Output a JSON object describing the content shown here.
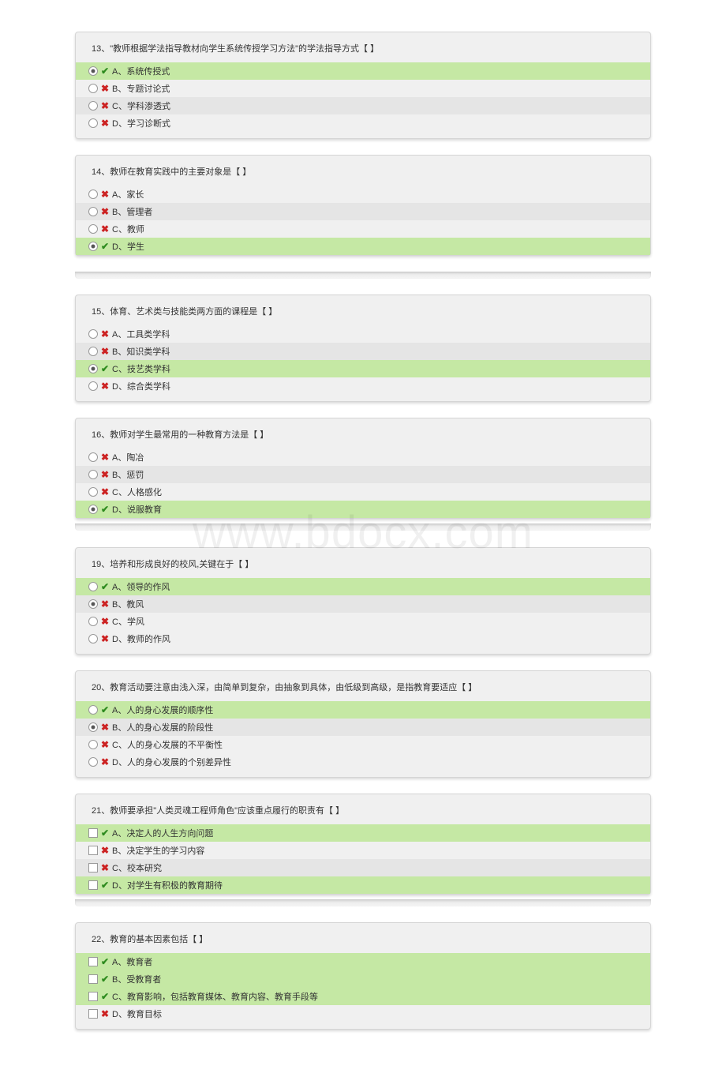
{
  "watermark": "www.bdocx.com",
  "questions": [
    {
      "num": "13",
      "title": "13、\"教师根据学法指导教材向学生系统传授学习方法\"的学法指导方式【  】",
      "options": [
        {
          "mark": "check",
          "text": "A、系统传授式",
          "correct": true,
          "selected": true
        },
        {
          "mark": "cross",
          "text": "B、专题讨论式",
          "alt": false
        },
        {
          "mark": "cross",
          "text": "C、学科渗透式",
          "alt": true
        },
        {
          "mark": "cross",
          "text": "D、学习诊断式",
          "alt": false
        }
      ]
    },
    {
      "num": "14",
      "title": "14、教师在教育实践中的主要对象是【  】",
      "options": [
        {
          "mark": "cross",
          "text": "A、家长",
          "alt": false
        },
        {
          "mark": "cross",
          "text": "B、管理者",
          "alt": true
        },
        {
          "mark": "cross",
          "text": "C、教师",
          "alt": false
        },
        {
          "mark": "check",
          "text": "D、学生",
          "correct": true,
          "selected": true
        }
      ],
      "nopad": true
    },
    {
      "num": "15",
      "title": "15、体育、艺术类与技能类两方面的课程是【  】",
      "options": [
        {
          "mark": "cross",
          "text": "A、工具类学科",
          "alt": false
        },
        {
          "mark": "cross",
          "text": "B、知识类学科",
          "alt": true
        },
        {
          "mark": "check",
          "text": "C、技艺类学科",
          "correct": true,
          "selected": true
        },
        {
          "mark": "cross",
          "text": "D、综合类学科",
          "alt": false
        }
      ]
    },
    {
      "num": "16",
      "title": "16、教师对学生最常用的一种教育方法是【  】",
      "options": [
        {
          "mark": "cross",
          "text": "A、陶冶",
          "alt": false
        },
        {
          "mark": "cross",
          "text": "B、惩罚",
          "alt": true
        },
        {
          "mark": "cross",
          "text": "C、人格感化",
          "alt": false
        },
        {
          "mark": "check",
          "text": "D、说服教育",
          "correct": true,
          "selected": true
        }
      ],
      "nopad": true
    },
    {
      "num": "19",
      "title": "19、培养和形成良好的校风,关键在于【  】",
      "options": [
        {
          "mark": "check",
          "text": "A、领导的作风",
          "correct": true
        },
        {
          "mark": "cross",
          "text": "B、教风",
          "alt": true,
          "selected": true
        },
        {
          "mark": "cross",
          "text": "C、学风",
          "alt": false
        },
        {
          "mark": "cross",
          "text": "D、教师的作风",
          "alt": false
        }
      ]
    },
    {
      "num": "20",
      "title": "20、教育活动要注意由浅入深，由简单到复杂，由抽象到具体，由低级到高级，是指教育要适应【  】",
      "options": [
        {
          "mark": "check",
          "text": "A、人的身心发展的顺序性",
          "correct": true
        },
        {
          "mark": "cross",
          "text": "B、人的身心发展的阶段性",
          "alt": true,
          "selected": true
        },
        {
          "mark": "cross",
          "text": "C、人的身心发展的不平衡性",
          "alt": false
        },
        {
          "mark": "cross",
          "text": "D、人的身心发展的个别差异性",
          "alt": false
        }
      ]
    },
    {
      "num": "21",
      "title": "21、教师要承担\"人类灵魂工程师角色\"应该重点履行的职责有【  】",
      "type": "multi",
      "options": [
        {
          "mark": "check",
          "text": "A、决定人的人生方向问题",
          "correct": true,
          "selected": true
        },
        {
          "mark": "cross",
          "text": "B、决定学生的学习内容",
          "alt": false
        },
        {
          "mark": "cross",
          "text": "C、校本研究",
          "alt": true
        },
        {
          "mark": "check",
          "text": "D、对学生有积极的教育期待",
          "correct": true,
          "selected": true
        }
      ],
      "nopad": true
    },
    {
      "num": "22",
      "title": "22、教育的基本因素包括【  】",
      "type": "multi",
      "options": [
        {
          "mark": "check",
          "text": "A、教育者",
          "correct": true,
          "selected": true
        },
        {
          "mark": "check",
          "text": "B、受教育者",
          "correct": true,
          "selected": true
        },
        {
          "mark": "check",
          "text": "C、教育影响，包括教育媒体、教育内容、教育手段等",
          "correct": true,
          "selected": true
        },
        {
          "mark": "cross",
          "text": "D、教育目标",
          "alt": false
        }
      ]
    }
  ]
}
